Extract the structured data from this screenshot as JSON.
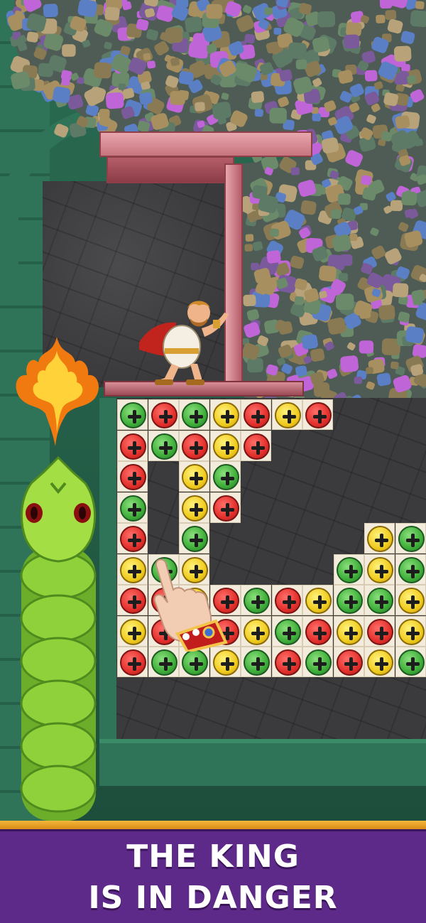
{
  "banner": {
    "line1": "THE KING",
    "line2": "IS IN DANGER"
  },
  "colors": {
    "banner_bg": "#5e2a8a",
    "banner_trim": "#f4b63a",
    "screw_red": "#e3302c",
    "screw_green": "#3fae3a",
    "screw_yellow": "#f0cc1f",
    "wall_green": "#2f7458",
    "pipe_pink": "#e8a6ad"
  },
  "icons": {
    "screw": "plus-screw-icon",
    "fire": "fire-icon",
    "hand": "pointing-hand-icon"
  },
  "board": {
    "rows": [
      [
        "red",
        "green",
        "yellow",
        "red",
        "yellow",
        "red",
        null,
        null,
        null,
        null
      ],
      [
        "red",
        "green",
        "red",
        "yellow",
        "red",
        null,
        null,
        null,
        null,
        null
      ],
      [
        "red",
        null,
        "yellow",
        "green",
        null,
        null,
        null,
        null,
        null,
        null
      ],
      [
        "green",
        null,
        "yellow",
        "red",
        null,
        null,
        null,
        null,
        null,
        null
      ],
      [
        "red",
        null,
        "green",
        null,
        null,
        null,
        null,
        null,
        "yellow",
        "green"
      ],
      [
        "yellow",
        "green",
        "yellow",
        null,
        null,
        null,
        null,
        "green",
        "yellow",
        "green"
      ],
      [
        "red",
        "red",
        "yellow",
        "red",
        "green",
        "red",
        "yellow",
        "green",
        "green",
        "yellow"
      ],
      [
        "yellow",
        "red",
        "green",
        "red",
        "yellow",
        "green",
        "red",
        "yellow",
        "red",
        "yellow"
      ],
      [
        "red",
        "green",
        "green",
        "yellow",
        "green",
        "red",
        "green",
        "red",
        "yellow",
        "green"
      ]
    ],
    "first_row_leading": "green"
  }
}
